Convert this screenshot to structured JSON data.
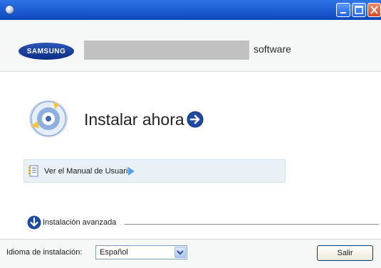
{
  "header": {
    "logo_text": "SAMSUNG",
    "software_label": "software"
  },
  "main": {
    "install_now": "Instalar ahora",
    "manual_link": "Ver el Manual de Usuario",
    "advanced_install": "Instalación avanzada"
  },
  "footer": {
    "language_label": "Idioma de instalación:",
    "language_selected": "Español",
    "exit_label": "Salir"
  },
  "colors": {
    "titlebar": "#1f5fd6",
    "logo": "#1b3f9e",
    "arrow_icon": "#1e4ba0",
    "close_button": "#d34a25"
  },
  "icons": {
    "app": "app-icon",
    "minimize": "minimize-icon",
    "maximize": "maximize-icon",
    "close": "close-icon",
    "install": "install-cd-icon",
    "go": "arrow-right-circle-icon",
    "manual": "manual-book-icon",
    "play": "triangle-right-icon",
    "advanced": "arrow-down-circle-icon",
    "dropdown": "chevron-down-icon"
  }
}
